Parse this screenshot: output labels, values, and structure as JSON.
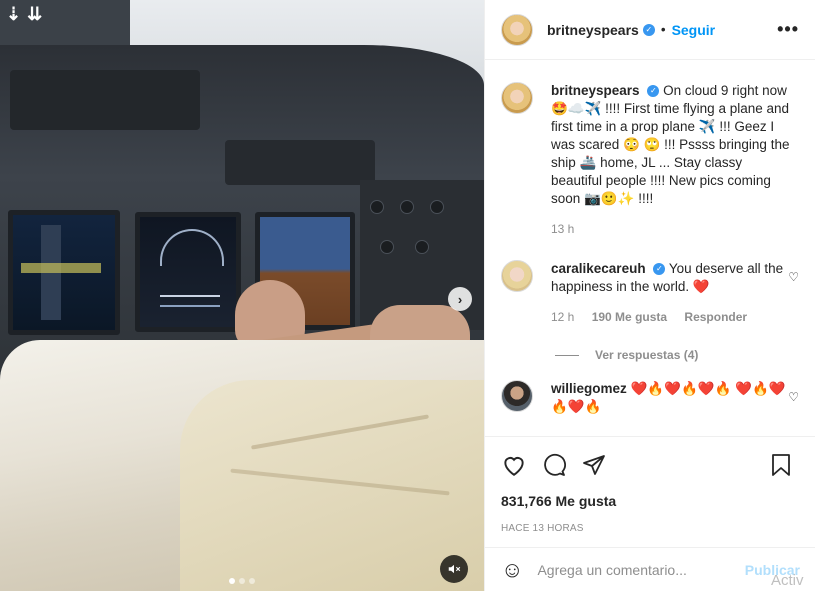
{
  "media": {
    "nav_icons": [
      "download-arrow-icon",
      "double-download-arrow-icon"
    ],
    "next_icon": "chevron-right-icon",
    "carousel": {
      "count": 3,
      "active_index": 0
    },
    "mute_icon": "muted-speaker-icon"
  },
  "header": {
    "username": "britneyspears",
    "separator": "•",
    "follow_label": "Seguir",
    "more_label": "•••"
  },
  "caption": {
    "username": "britneyspears",
    "text": "On cloud 9 right now 🤩☁️✈️ !!!! First time flying a plane and first time in a prop plane ✈️ !!! Geez I was scared 😳 🙄 !!! Pssss bringing the ship 🚢 home, JL ... Stay classy beautiful people !!!! New pics coming soon 📷🙂✨ !!!!",
    "time": "13 h"
  },
  "comments": [
    {
      "username": "caralikecareuh",
      "text": "You deserve all the happiness in the world. ❤️",
      "time": "12 h",
      "likes": "190 Me gusta",
      "reply_label": "Responder",
      "view_replies": "Ver respuestas (4)"
    },
    {
      "username": "williegomez",
      "text": "❤️🔥❤️🔥❤️🔥 ❤️🔥❤️🔥❤️🔥"
    }
  ],
  "actions": {
    "icons": [
      "heart-icon",
      "comment-icon",
      "share-icon",
      "bookmark-icon"
    ],
    "likes": "831,766 Me gusta",
    "timestamp": "HACE 13 HORAS"
  },
  "add_comment": {
    "placeholder": "Agrega un comentario...",
    "post_label": "Publicar",
    "emoji_icon": "smile-icon"
  },
  "watermark": "Activ",
  "colors": {
    "link_blue": "#0095f6",
    "verified_blue": "#3897f0",
    "muted_text": "#8e8e8e",
    "post_disabled": "#b2dffc"
  }
}
